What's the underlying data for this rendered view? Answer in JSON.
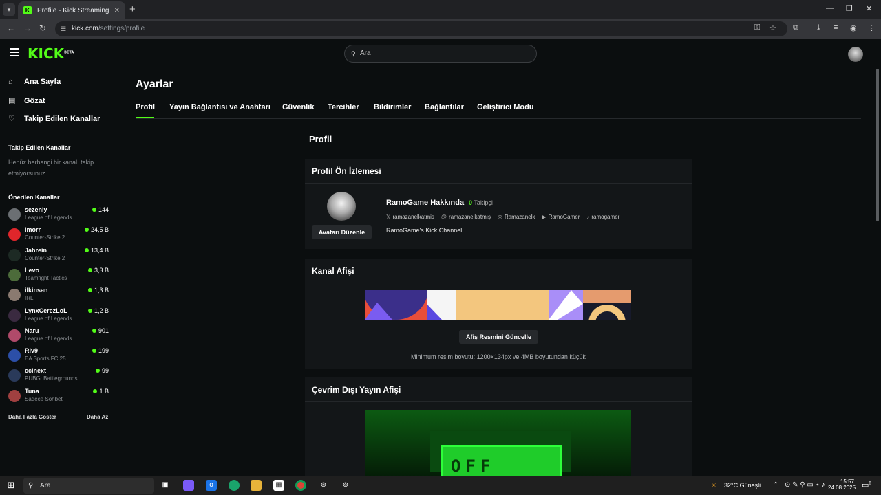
{
  "browser": {
    "tab_title": "Profile - Kick Streaming",
    "url_host": "kick.com",
    "url_path": "/settings/profile"
  },
  "header": {
    "logo": "KICK",
    "logo_badge": "BETA",
    "search_placeholder": "Ara"
  },
  "sidebar": {
    "nav": [
      {
        "label": "Ana Sayfa",
        "icon": "home-icon"
      },
      {
        "label": "Gözat",
        "icon": "browse-icon"
      },
      {
        "label": "Takip Edilen Kanallar",
        "icon": "heart-icon"
      }
    ],
    "followed_title": "Takip Edilen Kanallar",
    "followed_empty": "Henüz herhangi bir kanalı takip etmiyorsunuz.",
    "recommended_title": "Önerilen Kanallar",
    "channels": [
      {
        "name": "sezenly",
        "category": "League of Legends",
        "viewers": "144",
        "color": "#6b6f73"
      },
      {
        "name": "imorr",
        "category": "Counter-Strike 2",
        "viewers": "24,5 B",
        "color": "#e0262b"
      },
      {
        "name": "Jahrein",
        "category": "Counter-Strike 2",
        "viewers": "13,4 B",
        "color": "#1d2a24"
      },
      {
        "name": "Levo",
        "category": "Teamfight Tactics",
        "viewers": "3,3 B",
        "color": "#4c6b3a"
      },
      {
        "name": "ilkinsan",
        "category": "IRL",
        "viewers": "1,3 B",
        "color": "#8a7a70"
      },
      {
        "name": "LynxCerezLoL",
        "category": "League of Legends",
        "viewers": "1,2 B",
        "color": "#3a2a40"
      },
      {
        "name": "Naru",
        "category": "League of Legends",
        "viewers": "901",
        "color": "#b04a6a"
      },
      {
        "name": "Riv9",
        "category": "EA Sports FC 25",
        "viewers": "199",
        "color": "#2c4fa8"
      },
      {
        "name": "ccinext",
        "category": "PUBG: Battlegrounds",
        "viewers": "99",
        "color": "#2a3a5a"
      },
      {
        "name": "Tuna",
        "category": "Sadece Sohbet",
        "viewers": "1 B",
        "color": "#a04040"
      }
    ],
    "show_more": "Daha Fazla Göster",
    "show_less": "Daha Az"
  },
  "main": {
    "title": "Ayarlar",
    "tabs": [
      "Profil",
      "Yayın Bağlantısı ve Anahtarı",
      "Güvenlik",
      "Tercihler",
      "Bildirimler",
      "Bağlantılar",
      "Geliştirici Modu"
    ],
    "section_title": "Profil",
    "preview": {
      "title": "Profil Ön İzlemesi",
      "edit_avatar": "Avatarı Düzenle",
      "about": "RamoGame Hakkında",
      "followers_count": "0",
      "followers_label": "Takipçi",
      "socials": [
        {
          "icon": "x-icon",
          "glyph": "𝕏",
          "label": "ramazanelkatmis"
        },
        {
          "icon": "threads-icon",
          "glyph": "@",
          "label": "ramazanelkatmış"
        },
        {
          "icon": "instagram-icon",
          "glyph": "◎",
          "label": "Ramazanelk"
        },
        {
          "icon": "youtube-icon",
          "glyph": "▶",
          "label": "RamoGamer"
        },
        {
          "icon": "tiktok-icon",
          "glyph": "♪",
          "label": "ramogamer"
        }
      ],
      "description": "RamoGame's Kick Channel"
    },
    "banner": {
      "title": "Kanal Afişi",
      "update_button": "Afiş Resmini Güncelle",
      "hint": "Minimum resim boyutu: 1200×134px ve 4MB boyutundan küçük"
    },
    "offline": {
      "title": "Çevrim Dışı Yayın Afişi",
      "sign_text": "OFF"
    }
  },
  "taskbar": {
    "search": "Ara",
    "weather": "32°C  Güneşli",
    "time": "15:57",
    "date": "24.08.2025",
    "notif_count": "8"
  },
  "colors": {
    "accent": "#53fc18",
    "bg": "#0b0e0f",
    "card": "#131618"
  }
}
